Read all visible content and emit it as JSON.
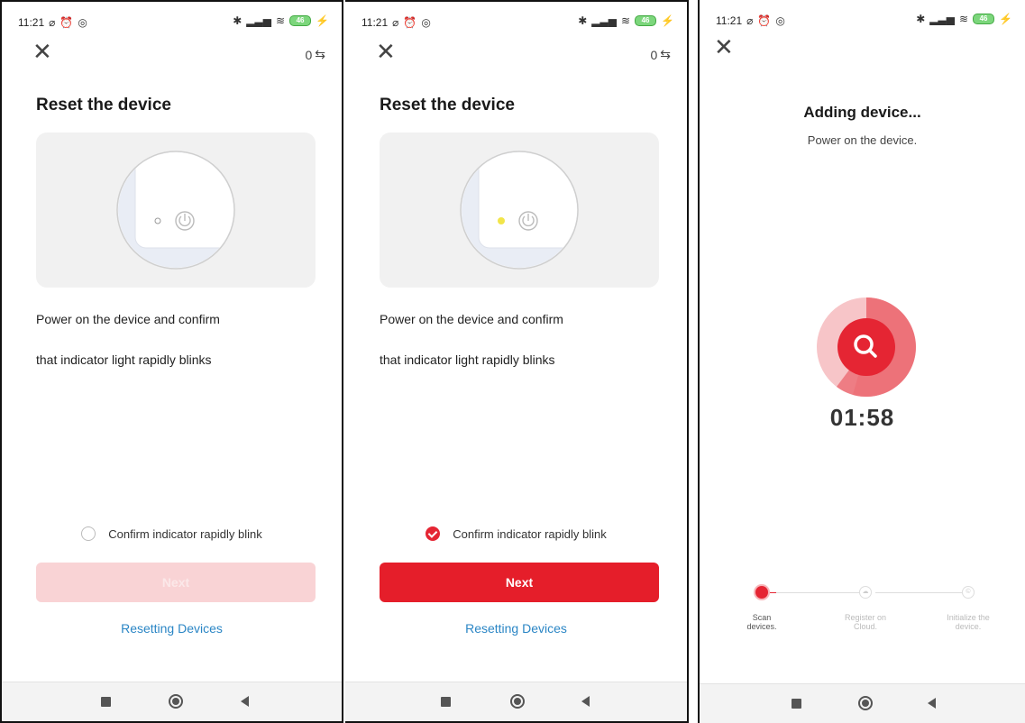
{
  "status": {
    "time": "11:21",
    "battery": "46"
  },
  "screens": [
    {
      "counter": "0",
      "title": "Reset the device",
      "desc_line1": "Power on the device and confirm",
      "desc_line2": "that indicator light rapidly blinks",
      "confirm_label": "Confirm indicator rapidly blink",
      "confirm_checked": false,
      "next_label": "Next",
      "next_enabled": false,
      "reset_link": "Resetting Devices",
      "indicator_color": "#ffffff"
    },
    {
      "counter": "0",
      "title": "Reset the device",
      "desc_line1": "Power on the device and confirm",
      "desc_line2": "that indicator light rapidly blinks",
      "confirm_label": "Confirm indicator rapidly blink",
      "confirm_checked": true,
      "next_label": "Next",
      "next_enabled": true,
      "reset_link": "Resetting Devices",
      "indicator_color": "#f2e54a"
    },
    {
      "title": "Adding device...",
      "subtitle": "Power on the device.",
      "timer": "01:58",
      "steps": [
        {
          "line1": "Scan",
          "line2": "devices.",
          "active": true
        },
        {
          "line1": "Register on",
          "line2": "Cloud.",
          "active": false
        },
        {
          "line1": "Initialize the",
          "line2": "device.",
          "active": false
        }
      ]
    }
  ],
  "colors": {
    "accent": "#e51e2a",
    "link": "#2b86c5",
    "next_disabled": "#f9d3d5"
  },
  "icons": {
    "close": "close-icon",
    "transfer": "transfer-arrows-icon",
    "power": "power-icon",
    "search": "search-icon",
    "nav_recent": "square-icon",
    "nav_home": "circle-icon",
    "nav_back": "triangle-back-icon"
  }
}
